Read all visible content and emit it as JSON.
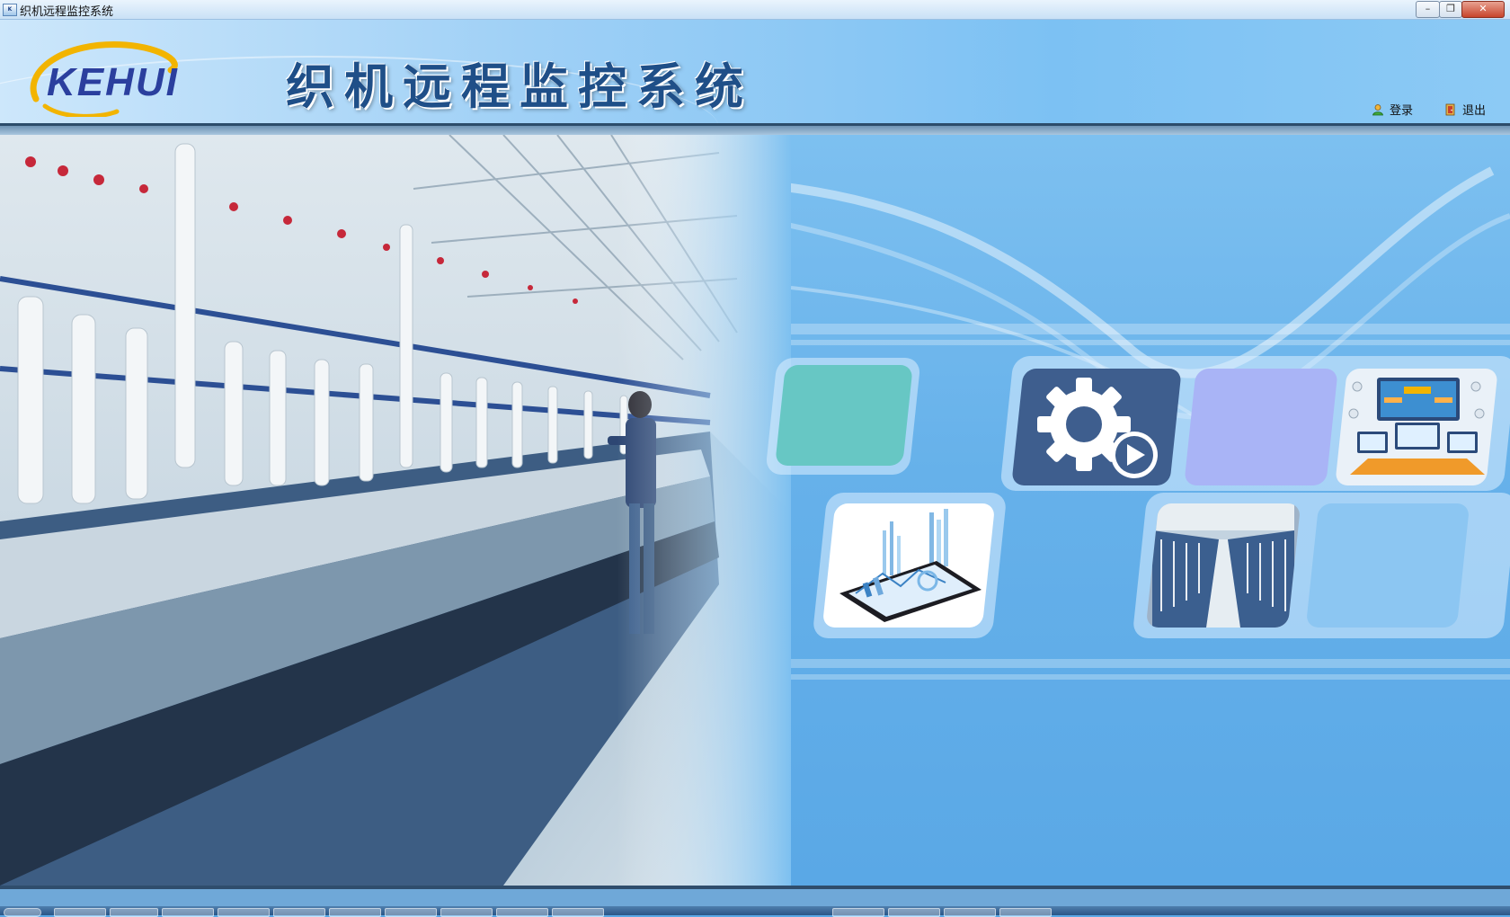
{
  "window": {
    "title": "织机远程监控系统",
    "controls": {
      "minimize": "–",
      "maximize": "❐",
      "close": "✕"
    }
  },
  "header": {
    "logo_text": "KEHUI",
    "app_title": "织机远程监控系统",
    "login_label": "登录",
    "logout_label": "退出",
    "login_icon": "user-icon",
    "logout_icon": "exit-door-icon"
  },
  "tiles": [
    {
      "name": "tile-teal-empty",
      "color": "#67c7c4",
      "icon": ""
    },
    {
      "name": "tile-settings-play",
      "color": "#3e5e8e",
      "icon": "gear-play-icon"
    },
    {
      "name": "tile-lavender-empty",
      "color": "#a9b4f6",
      "icon": ""
    },
    {
      "name": "tile-monitor-screens",
      "color": "#eaf1f8",
      "icon": "monitor-network-icon"
    },
    {
      "name": "tile-mobile-analytics",
      "color": "#ffffff",
      "icon": "phone-chart-icon"
    },
    {
      "name": "tile-factory-photo",
      "color": "#9fb3c8",
      "icon": "factory-aisle-image"
    },
    {
      "name": "tile-lightblue-empty",
      "color": "#8cc6f2",
      "icon": ""
    }
  ],
  "colors": {
    "title_text": "#1f4f88",
    "logo_blue": "#2b3f9e",
    "logo_arc": "#f2b400",
    "background": "#5aa8e6"
  }
}
